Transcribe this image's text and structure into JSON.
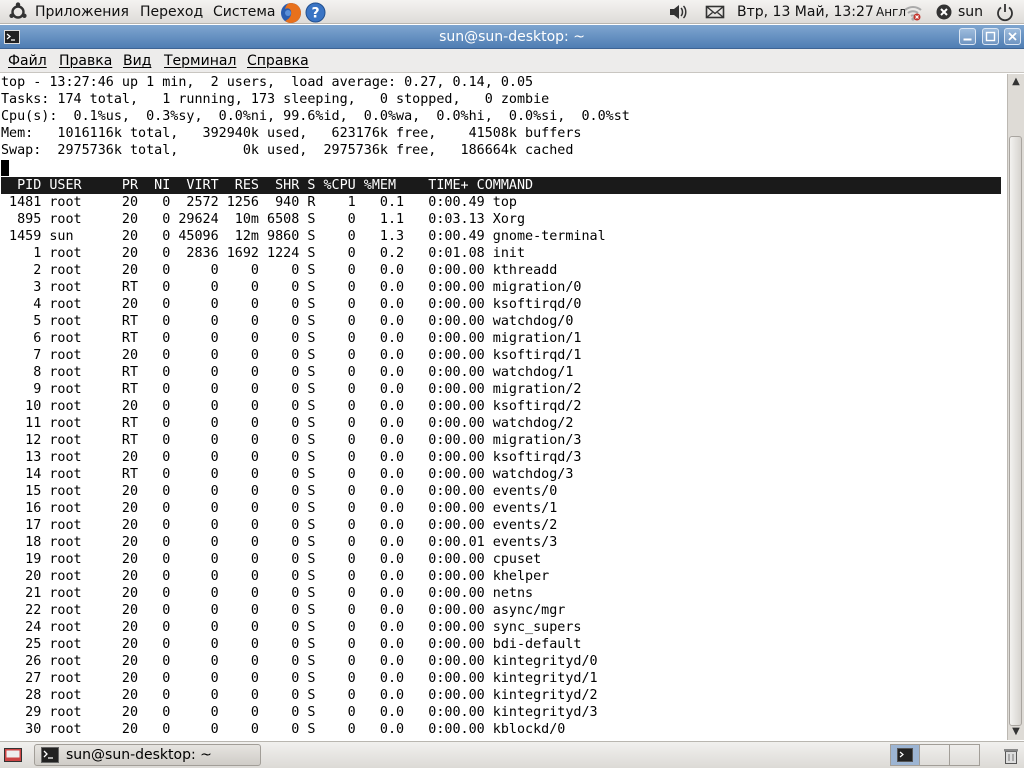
{
  "top_panel": {
    "menus": [
      "Приложения",
      "Переход",
      "Система"
    ],
    "icons": [
      "ubuntu-logo-icon",
      "firefox-icon",
      "help-icon",
      "volume-icon",
      "mail-icon",
      "network-wireless-icon",
      "logout-icon",
      "power-icon"
    ],
    "clock": "Втр, 13 Май, 13:27",
    "keyboard_layout": "Англ",
    "user": "sun"
  },
  "window": {
    "title": "sun@sun-desktop: ~",
    "menus": [
      "Файл",
      "Правка",
      "Вид",
      "Терминал",
      "Справка"
    ]
  },
  "terminal": {
    "summary": [
      "top - 13:27:46 up 1 min,  2 users,  load average: 0.27, 0.14, 0.05",
      "Tasks: 174 total,   1 running, 173 sleeping,   0 stopped,   0 zombie",
      "Cpu(s):  0.1%us,  0.3%sy,  0.0%ni, 99.6%id,  0.0%wa,  0.0%hi,  0.0%si,  0.0%st",
      "Mem:   1016116k total,   392940k used,   623176k free,    41508k buffers",
      "Swap:  2975736k total,        0k used,  2975736k free,   186664k cached"
    ],
    "columns": [
      "PID",
      "USER",
      "PR",
      "NI",
      "VIRT",
      "RES",
      "SHR",
      "S",
      "%CPU",
      "%MEM",
      "TIME+",
      "COMMAND"
    ],
    "processes": [
      [
        "1481",
        "root",
        "20",
        "0",
        "2572",
        "1256",
        "940",
        "R",
        "1",
        "0.1",
        "0:00.49",
        "top"
      ],
      [
        "895",
        "root",
        "20",
        "0",
        "29624",
        "10m",
        "6508",
        "S",
        "0",
        "1.1",
        "0:03.13",
        "Xorg"
      ],
      [
        "1459",
        "sun",
        "20",
        "0",
        "45096",
        "12m",
        "9860",
        "S",
        "0",
        "1.3",
        "0:00.49",
        "gnome-terminal"
      ],
      [
        "1",
        "root",
        "20",
        "0",
        "2836",
        "1692",
        "1224",
        "S",
        "0",
        "0.2",
        "0:01.08",
        "init"
      ],
      [
        "2",
        "root",
        "20",
        "0",
        "0",
        "0",
        "0",
        "S",
        "0",
        "0.0",
        "0:00.00",
        "kthreadd"
      ],
      [
        "3",
        "root",
        "RT",
        "0",
        "0",
        "0",
        "0",
        "S",
        "0",
        "0.0",
        "0:00.00",
        "migration/0"
      ],
      [
        "4",
        "root",
        "20",
        "0",
        "0",
        "0",
        "0",
        "S",
        "0",
        "0.0",
        "0:00.00",
        "ksoftirqd/0"
      ],
      [
        "5",
        "root",
        "RT",
        "0",
        "0",
        "0",
        "0",
        "S",
        "0",
        "0.0",
        "0:00.00",
        "watchdog/0"
      ],
      [
        "6",
        "root",
        "RT",
        "0",
        "0",
        "0",
        "0",
        "S",
        "0",
        "0.0",
        "0:00.00",
        "migration/1"
      ],
      [
        "7",
        "root",
        "20",
        "0",
        "0",
        "0",
        "0",
        "S",
        "0",
        "0.0",
        "0:00.00",
        "ksoftirqd/1"
      ],
      [
        "8",
        "root",
        "RT",
        "0",
        "0",
        "0",
        "0",
        "S",
        "0",
        "0.0",
        "0:00.00",
        "watchdog/1"
      ],
      [
        "9",
        "root",
        "RT",
        "0",
        "0",
        "0",
        "0",
        "S",
        "0",
        "0.0",
        "0:00.00",
        "migration/2"
      ],
      [
        "10",
        "root",
        "20",
        "0",
        "0",
        "0",
        "0",
        "S",
        "0",
        "0.0",
        "0:00.00",
        "ksoftirqd/2"
      ],
      [
        "11",
        "root",
        "RT",
        "0",
        "0",
        "0",
        "0",
        "S",
        "0",
        "0.0",
        "0:00.00",
        "watchdog/2"
      ],
      [
        "12",
        "root",
        "RT",
        "0",
        "0",
        "0",
        "0",
        "S",
        "0",
        "0.0",
        "0:00.00",
        "migration/3"
      ],
      [
        "13",
        "root",
        "20",
        "0",
        "0",
        "0",
        "0",
        "S",
        "0",
        "0.0",
        "0:00.00",
        "ksoftirqd/3"
      ],
      [
        "14",
        "root",
        "RT",
        "0",
        "0",
        "0",
        "0",
        "S",
        "0",
        "0.0",
        "0:00.00",
        "watchdog/3"
      ],
      [
        "15",
        "root",
        "20",
        "0",
        "0",
        "0",
        "0",
        "S",
        "0",
        "0.0",
        "0:00.00",
        "events/0"
      ],
      [
        "16",
        "root",
        "20",
        "0",
        "0",
        "0",
        "0",
        "S",
        "0",
        "0.0",
        "0:00.00",
        "events/1"
      ],
      [
        "17",
        "root",
        "20",
        "0",
        "0",
        "0",
        "0",
        "S",
        "0",
        "0.0",
        "0:00.00",
        "events/2"
      ],
      [
        "18",
        "root",
        "20",
        "0",
        "0",
        "0",
        "0",
        "S",
        "0",
        "0.0",
        "0:00.01",
        "events/3"
      ],
      [
        "19",
        "root",
        "20",
        "0",
        "0",
        "0",
        "0",
        "S",
        "0",
        "0.0",
        "0:00.00",
        "cpuset"
      ],
      [
        "20",
        "root",
        "20",
        "0",
        "0",
        "0",
        "0",
        "S",
        "0",
        "0.0",
        "0:00.00",
        "khelper"
      ],
      [
        "21",
        "root",
        "20",
        "0",
        "0",
        "0",
        "0",
        "S",
        "0",
        "0.0",
        "0:00.00",
        "netns"
      ],
      [
        "22",
        "root",
        "20",
        "0",
        "0",
        "0",
        "0",
        "S",
        "0",
        "0.0",
        "0:00.00",
        "async/mgr"
      ],
      [
        "24",
        "root",
        "20",
        "0",
        "0",
        "0",
        "0",
        "S",
        "0",
        "0.0",
        "0:00.00",
        "sync_supers"
      ],
      [
        "25",
        "root",
        "20",
        "0",
        "0",
        "0",
        "0",
        "S",
        "0",
        "0.0",
        "0:00.00",
        "bdi-default"
      ],
      [
        "26",
        "root",
        "20",
        "0",
        "0",
        "0",
        "0",
        "S",
        "0",
        "0.0",
        "0:00.00",
        "kintegrityd/0"
      ],
      [
        "27",
        "root",
        "20",
        "0",
        "0",
        "0",
        "0",
        "S",
        "0",
        "0.0",
        "0:00.00",
        "kintegrityd/1"
      ],
      [
        "28",
        "root",
        "20",
        "0",
        "0",
        "0",
        "0",
        "S",
        "0",
        "0.0",
        "0:00.00",
        "kintegrityd/2"
      ],
      [
        "29",
        "root",
        "20",
        "0",
        "0",
        "0",
        "0",
        "S",
        "0",
        "0.0",
        "0:00.00",
        "kintegrityd/3"
      ],
      [
        "30",
        "root",
        "20",
        "0",
        "0",
        "0",
        "0",
        "S",
        "0",
        "0.0",
        "0:00.00",
        "kblockd/0"
      ]
    ]
  },
  "taskbar": {
    "window_button_label": "sun@sun-desktop: ~",
    "icons": [
      "show-desktop-icon",
      "terminal-icon",
      "workspace-switcher-icon"
    ]
  },
  "colors": {
    "panel_bg": "#e4e2de",
    "titlebar": "#5b88bd",
    "header_bar": "#1a1a1a",
    "terminal_bg": "#ffffff"
  }
}
